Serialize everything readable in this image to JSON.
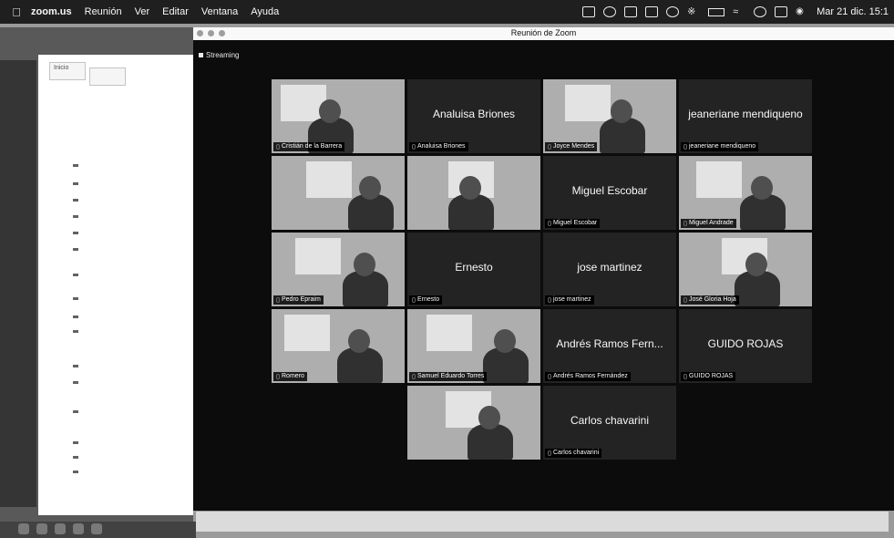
{
  "menubar": {
    "app": "zoom.us",
    "items": [
      "Reunión",
      "Ver",
      "Editar",
      "Ventana",
      "Ayuda"
    ],
    "clock": "Mar 21 dic. 15:1"
  },
  "window": {
    "title": "Reunión de Zoom",
    "streaming": "Streaming"
  },
  "tiles": [
    {
      "type": "video",
      "label": "Cristián de la Barrera"
    },
    {
      "type": "name",
      "center": "Analuisa Briones",
      "label": "Analuisa Briones"
    },
    {
      "type": "video",
      "label": "Joyce Mendes"
    },
    {
      "type": "name",
      "center": "jeaneriane mendiqueno",
      "label": "jeaneriane mendiqueno"
    },
    {
      "type": "video",
      "label": ""
    },
    {
      "type": "video",
      "label": ""
    },
    {
      "type": "name",
      "center": "Miguel Escobar",
      "label": "Miguel Escobar"
    },
    {
      "type": "video",
      "label": "Miguel Andrade"
    },
    {
      "type": "video",
      "label": "Pedro Epraim"
    },
    {
      "type": "name",
      "center": "Ernesto",
      "label": "Ernesto"
    },
    {
      "type": "name",
      "center": "jose martinez",
      "label": "jose martinez"
    },
    {
      "type": "video",
      "label": "José Gloria Hoja"
    },
    {
      "type": "video",
      "label": "Romero"
    },
    {
      "type": "video",
      "label": "Samuel Eduardo Torres"
    },
    {
      "type": "name",
      "center": "Andrés Ramos Fern...",
      "label": "Andrés Ramos Fernández"
    },
    {
      "type": "name",
      "center": "GUIDO ROJAS",
      "label": "GUIDO ROJAS"
    },
    {
      "type": "video",
      "label": ""
    },
    {
      "type": "name",
      "center": "Carlos chavarini",
      "label": "Carlos chavarini"
    }
  ],
  "captions": {
    "line1": "",
    "line2": ""
  },
  "background_doc": {
    "tab1": "Inicio",
    "tab2": "",
    "footer": ""
  }
}
